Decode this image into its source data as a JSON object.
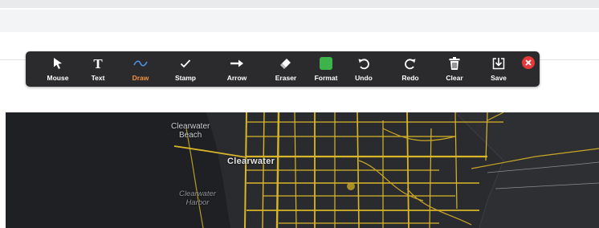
{
  "toolbar": {
    "tools": [
      {
        "label": "Mouse",
        "icon": "cursor-icon"
      },
      {
        "label": "Text",
        "icon": "text-icon"
      },
      {
        "label": "Draw",
        "icon": "draw-icon",
        "active": true
      },
      {
        "label": "Stamp",
        "icon": "checkmark-icon"
      },
      {
        "label": "Arrow",
        "icon": "arrow-icon"
      },
      {
        "label": "Eraser",
        "icon": "eraser-icon"
      },
      {
        "label": "Format",
        "icon": "format-swatch-icon"
      },
      {
        "label": "Undo",
        "icon": "undo-icon"
      },
      {
        "label": "Redo",
        "icon": "redo-icon"
      },
      {
        "label": "Clear",
        "icon": "trash-icon"
      },
      {
        "label": "Save",
        "icon": "save-icon"
      }
    ],
    "close_icon": "close-icon"
  },
  "colors": {
    "toolbar_bg": "#2b2b2d",
    "active_label": "#f1923a",
    "draw_icon": "#4a90e2",
    "format_swatch": "#3cb44b",
    "close_red": "#e5393b",
    "map_bg": "#2a2b2e",
    "road": "#d9b52a"
  },
  "map": {
    "labels": {
      "beach": "Clearwater\nBeach",
      "city": "Clearwater",
      "harbor": "Clearwater\nHarbor"
    }
  }
}
